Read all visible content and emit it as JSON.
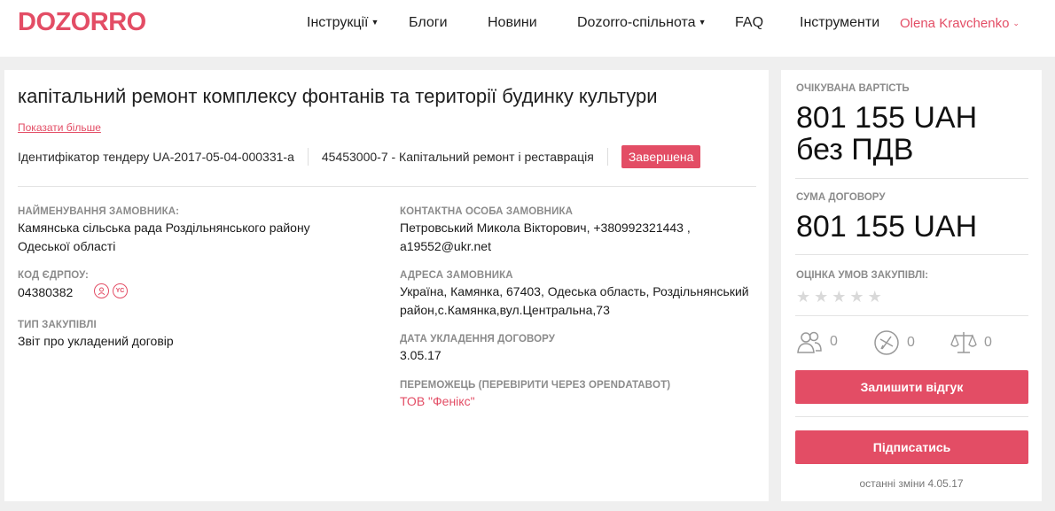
{
  "header": {
    "logo": "DOZORRO",
    "nav": [
      {
        "label": "Інструкції",
        "has_dropdown": true
      },
      {
        "label": "Блоги",
        "has_dropdown": false
      },
      {
        "label": "Новини",
        "has_dropdown": false
      },
      {
        "label": "Dozorro-спільнота",
        "has_dropdown": true
      },
      {
        "label": "FAQ",
        "has_dropdown": false
      },
      {
        "label": "Інструменти",
        "has_dropdown": false
      }
    ],
    "user": "Olena Kravchenko"
  },
  "tender": {
    "title": "капітальний ремонт комплексу фонтанів та території будинку культури",
    "show_more": "Показати більше",
    "id_text": "Ідентифікатор тендеру UA-2017-05-04-000331-a",
    "cpv": "45453000-7 - Капітальний ремонт і реставрація",
    "status": "Завершена"
  },
  "details": {
    "buyer_label": "НАЙМЕНУВАННЯ ЗАМОВНИКА:",
    "buyer_value": "Камянська сільська рада Роздільнянського району Одеської області",
    "edrpou_label": "КОД ЄДРПОУ:",
    "edrpou_value": "04380382",
    "edrpou_icons": [
      "person-icon",
      "yc-icon"
    ],
    "edrpou_icon_text": "YC",
    "type_label": "ТИП ЗАКУПІВЛІ",
    "type_value": "Звіт про укладений договір",
    "contact_label": "КОНТАКТНА ОСОБА ЗАМОВНИКА",
    "contact_value": "Петровський Микола Вікторович, +380992321443 , a19552@ukr.net",
    "address_label": "АДРЕСА ЗАМОВНИКА",
    "address_value": "Україна, Камянка, 67403, Одеська область, Роздільнянський район,с.Камянка,вул.Центральна,73",
    "date_label": "ДАТА УКЛАДЕННЯ ДОГОВОРУ",
    "date_value": "3.05.17",
    "winner_label": "ПЕРЕМОЖЕЦЬ (ПЕРЕВІРИТИ ЧЕРЕЗ OPENDATABOT)",
    "winner_value": "ТОВ \"Фенікс\""
  },
  "sidebar": {
    "expected_label": "ОЧІКУВАНА ВАРТІСТЬ",
    "expected_value_1": "801 155 UAH",
    "expected_value_2": "без ПДВ",
    "contract_label": "СУМА ДОГОВОРУ",
    "contract_value": "801 155 UAH",
    "rating_label": "ОЦІНКА УМОВ ЗАКУПІВЛІ:",
    "rating_stars_filled": 0,
    "rating_stars_total": 5,
    "stats": [
      {
        "icon": "users-icon",
        "value": "0"
      },
      {
        "icon": "no-edit-icon",
        "value": "0"
      },
      {
        "icon": "scales-icon",
        "value": "0"
      }
    ],
    "review_button": "Залишити відгук",
    "subscribe_button": "Підписатись",
    "last_changes": "останні зміни 4.05.17"
  },
  "colors": {
    "accent": "#e34d65",
    "background": "#efefef",
    "card": "#ffffff",
    "label_gray": "#8b8b8b"
  }
}
